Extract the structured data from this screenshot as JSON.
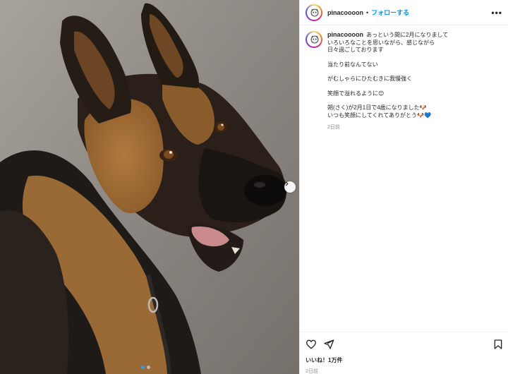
{
  "post": {
    "username": "pinacoooon",
    "separator": "•",
    "follow_label": "フォローする",
    "more_label": "•••"
  },
  "caption": {
    "username": "pinacoooon",
    "line1": "あっという間に2月になりまして",
    "line2": "いろいろなことを思いながら、感じながら",
    "line3": "日々過ごしております",
    "line4": "当たり前なんてない",
    "line5": "がむしゃらにひたむきに我慢強く",
    "line6": "笑顔で溢れるように😊",
    "line7": "朔(さく)が2月1日で4歳になりました🐶",
    "line8": "いつも笑顔にしてくれてありがとう🐶💙",
    "time": "2日前"
  },
  "footer": {
    "likes": "いいね！1万件",
    "date": "2日前"
  },
  "carousel": {
    "total": 2,
    "active": 1
  },
  "colors": {
    "accent": "#0095f6",
    "active_dot": "#3897f0"
  },
  "icons": [
    "heart-icon",
    "share-icon",
    "bookmark-icon",
    "chevron-right-icon",
    "more-icon"
  ]
}
